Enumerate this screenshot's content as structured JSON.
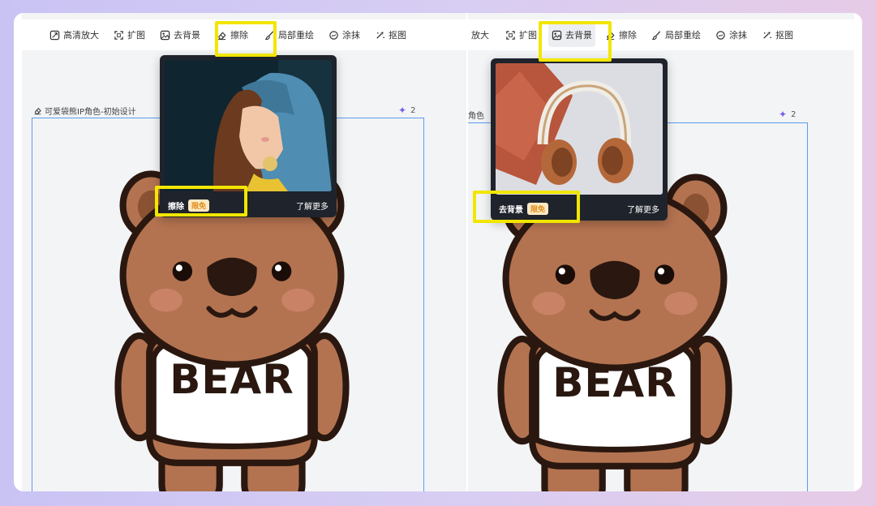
{
  "colors": {
    "highlight": "#f2e600",
    "frame": "#5b9cf0",
    "bear": "#b47350",
    "outline": "#2a1810"
  },
  "left": {
    "tools": [
      {
        "label": "高清放大",
        "icon": "hd-icon"
      },
      {
        "label": "扩图",
        "icon": "expand-icon"
      },
      {
        "label": "去背景",
        "icon": "remove-bg-icon"
      },
      {
        "label": "擦除",
        "icon": "eraser-icon"
      },
      {
        "label": "局部重绘",
        "icon": "brush-icon"
      },
      {
        "label": "涂抹",
        "icon": "smear-icon"
      },
      {
        "label": "抠图",
        "icon": "cutout-icon"
      }
    ],
    "canvas_title": "可爱袋熊IP角色-初始设计",
    "count": "2",
    "popup": {
      "name": "擦除",
      "badge": "限免",
      "more": "了解更多"
    },
    "bear_text": "BEAR"
  },
  "right": {
    "tools": [
      {
        "label": "放大",
        "icon": "hd-icon"
      },
      {
        "label": "扩图",
        "icon": "expand-icon"
      },
      {
        "label": "去背景",
        "icon": "remove-bg-icon"
      },
      {
        "label": "擦除",
        "icon": "eraser-icon"
      },
      {
        "label": "局部重绘",
        "icon": "brush-icon"
      },
      {
        "label": "涂抹",
        "icon": "smear-icon"
      },
      {
        "label": "抠图",
        "icon": "cutout-icon"
      }
    ],
    "canvas_title": "角色",
    "count": "2",
    "popup": {
      "name": "去背景",
      "badge": "限免",
      "more": "了解更多"
    },
    "bear_text": "BEAR"
  }
}
